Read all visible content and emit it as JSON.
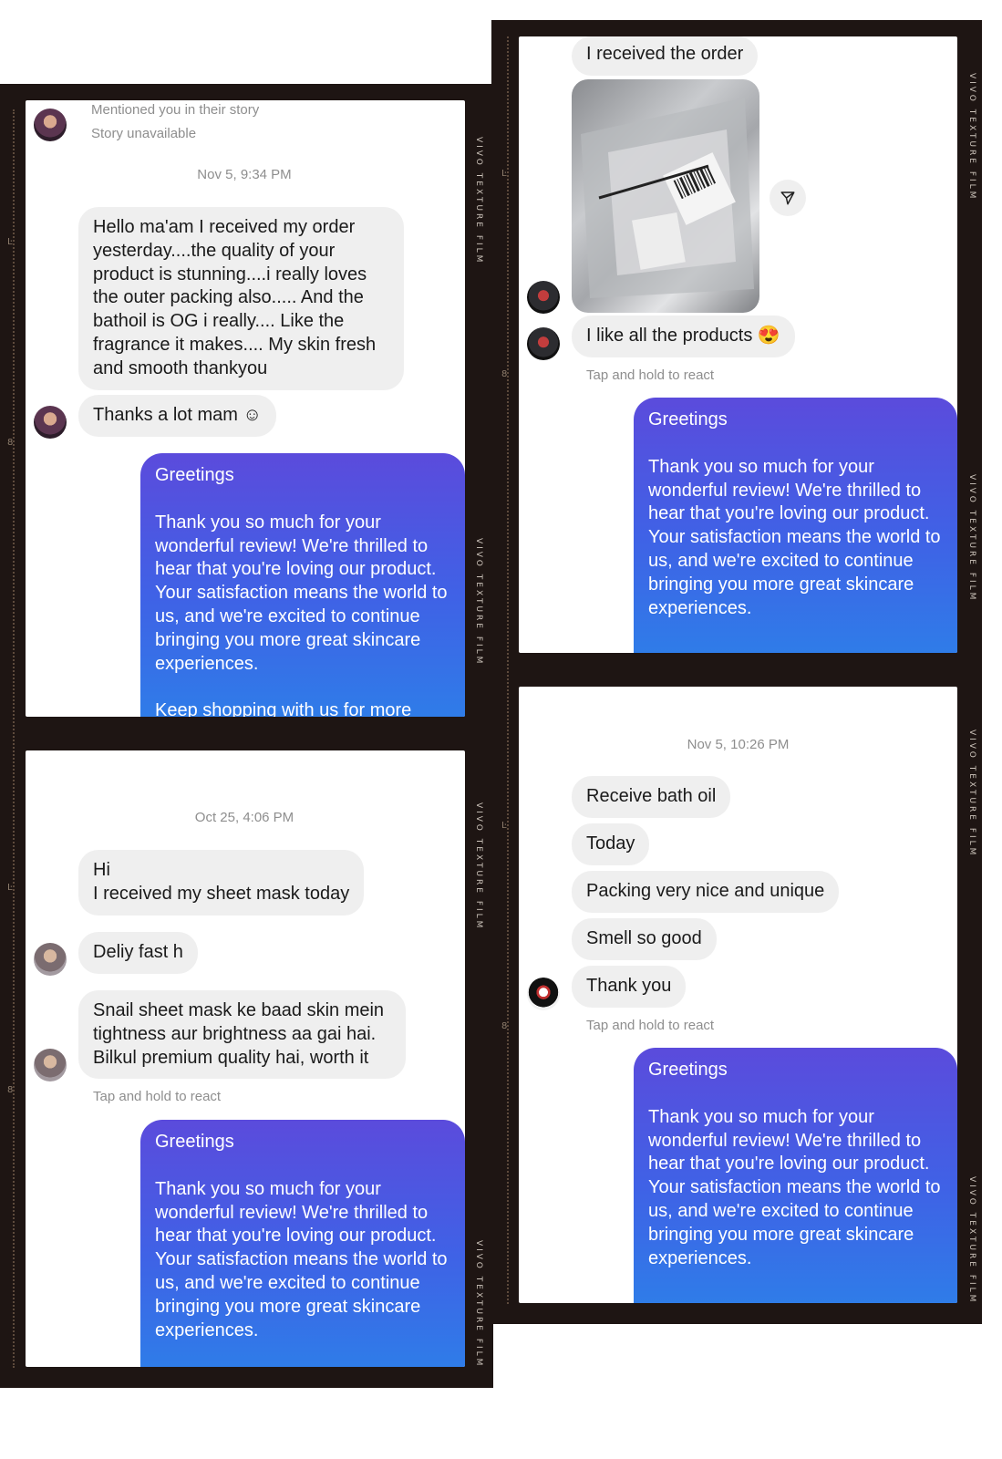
{
  "film_label": "VIVO TEXTURE FILM",
  "panel1": {
    "story_mention": "Mentioned you in their story",
    "story_status": "Story unavailable",
    "timestamp": "Nov 5, 9:34 PM",
    "message_1": "Hello ma'am I received my order yesterday....the quality of your product is stunning....i really loves the outer packing also..... And the bathoil is OG i really.... Like the fragrance it makes.... My skin fresh and smooth thankyou",
    "message_2": "Thanks a lot mam ☺",
    "reply_greeting": "Greetings",
    "reply_body": "Thank you so much for your wonderful review! We're thrilled to hear that you're loving our product. Your satisfaction means the world to us, and we're excited to continue bringing you more great skincare experiences.",
    "reply_cut": "Keep shopping with us for more"
  },
  "panel2": {
    "message_1": "I received  the order",
    "photo_icon": "package-photo",
    "share_icon": "send-icon",
    "message_2": "I like all the products 😍",
    "react_hint": "Tap and hold to react",
    "reply_greeting": "Greetings",
    "reply_body": "Thank you so much for your wonderful review! We're thrilled to hear that you're loving our product. Your satisfaction means the world to us, and we're excited to continue bringing you more great skincare experiences."
  },
  "panel3": {
    "timestamp": "Oct 25, 4:06 PM",
    "message_1": "Hi\nI received my sheet mask today",
    "message_2": "Deliy fast h",
    "message_3": "Snail sheet mask ke baad skin mein tightness aur brightness aa gai hai. Bilkul premium quality hai, worth it",
    "react_hint": "Tap and hold to react",
    "reply_greeting": "Greetings",
    "reply_body": "Thank you so much for your wonderful review! We're thrilled to hear that you're loving our product. Your satisfaction means the world to us, and we're excited to continue bringing you more great skincare experiences."
  },
  "panel4": {
    "timestamp": "Nov 5, 10:26 PM",
    "message_1": "Receive bath oil",
    "message_2": "Today",
    "message_3": "Packing very nice and unique",
    "message_4": "Smell so good",
    "message_5": "Thank you",
    "react_hint": "Tap and hold to react",
    "reply_greeting": "Greetings",
    "reply_body": "Thank you so much for your wonderful review! We're thrilled to hear that you're loving our product. Your satisfaction means the world to us, and we're excited to continue bringing you more great skincare experiences."
  },
  "colors": {
    "film": "#1e1513",
    "incoming_bubble": "#efefef",
    "outgoing_gradient_top": "#5b4bdc",
    "outgoing_gradient_bottom": "#2f7ce8"
  }
}
